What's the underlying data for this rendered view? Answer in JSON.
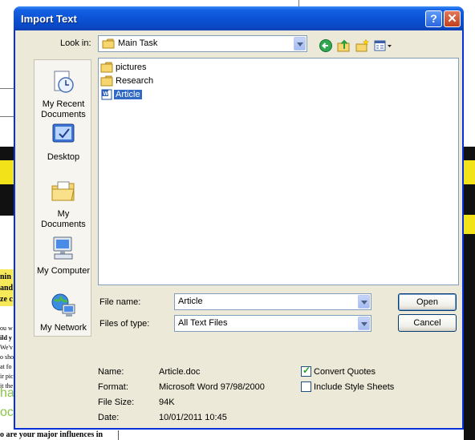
{
  "background": {
    "hl_lines": [
      "nin",
      "and",
      "ze c"
    ],
    "body_lines": [
      "ou w",
      "ild y",
      "We'v",
      "o sho",
      "at fo",
      "ir pic",
      "it the"
    ],
    "green_lines": [
      "ha",
      "oc"
    ],
    "bottom_text": "o are your major influences in"
  },
  "dialog": {
    "title": "Import Text",
    "help_label": "?",
    "close_label": "✕"
  },
  "toolbar": {
    "look_in_label": "Look in:",
    "look_in_value": "Main Task"
  },
  "places": [
    {
      "label": "My Recent Documents",
      "icon": "recent-documents-icon"
    },
    {
      "label": "Desktop",
      "icon": "desktop-icon"
    },
    {
      "label": "My Documents",
      "icon": "my-documents-icon"
    },
    {
      "label": "My Computer",
      "icon": "my-computer-icon"
    },
    {
      "label": "My Network",
      "icon": "my-network-icon"
    }
  ],
  "files": [
    {
      "name": "pictures",
      "type": "folder"
    },
    {
      "name": "Research",
      "type": "folder"
    },
    {
      "name": "Article",
      "type": "word-document",
      "selected": true
    }
  ],
  "form": {
    "file_name_label": "File name:",
    "file_name_value": "Article",
    "files_of_type_label": "Files of type:",
    "files_of_type_value": "All Text Files",
    "open_label": "Open",
    "cancel_label": "Cancel"
  },
  "info": {
    "name_label": "Name:",
    "name_value": "Article.doc",
    "format_label": "Format:",
    "format_value": "Microsoft Word 97/98/2000",
    "size_label": "File Size:",
    "size_value": "94K",
    "date_label": "Date:",
    "date_value": "10/01/2011 10:45"
  },
  "options": {
    "convert_quotes_label": "Convert Quotes",
    "convert_quotes_checked": true,
    "include_styles_label": "Include Style Sheets",
    "include_styles_checked": false
  },
  "colors": {
    "titlebar": "#0b51d4",
    "selection": "#316ac5",
    "dialog_face": "#ece9d8"
  }
}
